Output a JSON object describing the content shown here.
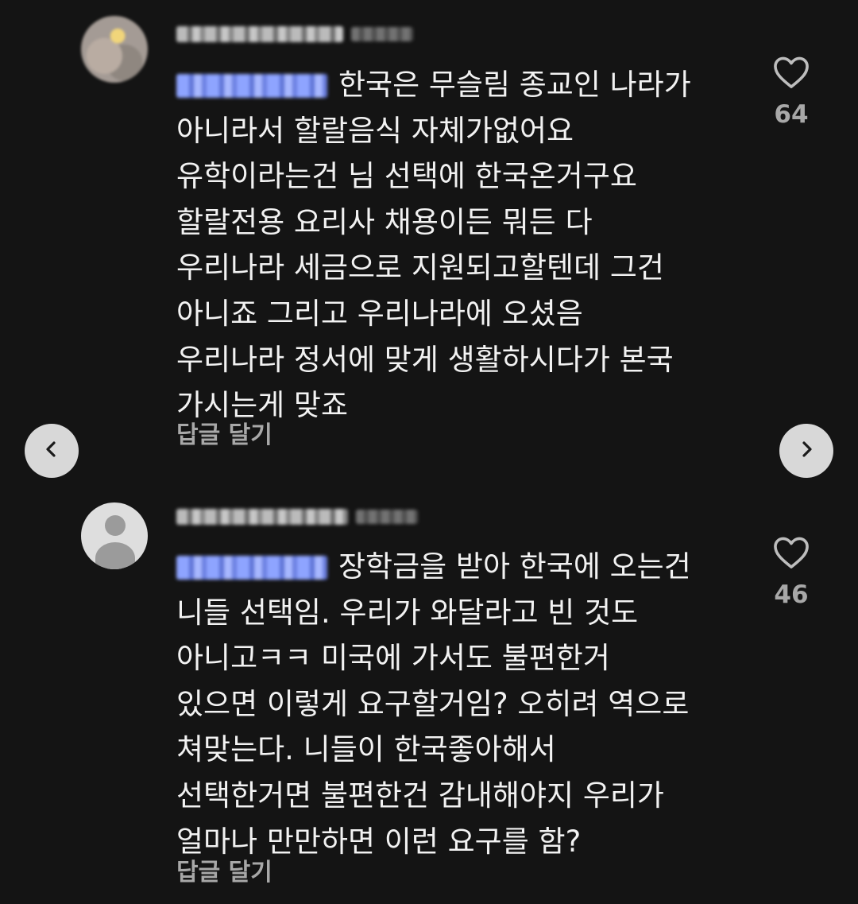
{
  "comments": [
    {
      "lines": [
        "한국은 무슬림 종교인 나라가",
        "아니라서 할랄음식 자체가없어요",
        "유학이라는건 님 선택에 한국온거구요",
        "할랄전용 요리사 채용이든 뭐든 다",
        "우리나라 세금으로 지원되고할텐데 그건",
        "아니죠 그리고 우리나라에 오셨음",
        "우리나라 정서에 맞게 생활하시다가 본국",
        "가시는게 맞죠"
      ],
      "reply_label": "답글 달기",
      "likes": "64"
    },
    {
      "lines": [
        "장학금을 받아 한국에 오는건",
        "니들 선택임. 우리가 와달라고 빈 것도",
        "아니고ㅋㅋ 미국에 가서도 불편한거",
        "있으면 이렇게 요구할거임? 오히려 역으로",
        "쳐맞는다. 니들이 한국좋아해서",
        "선택한거면 불편한건 감내해야지 우리가",
        "얼마나 만만하면 이런 요구를 함?"
      ],
      "reply_label": "답글 달기",
      "likes": "46"
    }
  ],
  "icons": {
    "like": "heart-outline-icon",
    "prev": "chevron-left-icon",
    "next": "chevron-right-icon"
  },
  "colors": {
    "background": "#141414",
    "text": "#f2f2f2",
    "secondary": "#a8a8a8",
    "mention": "#8ea4ff"
  }
}
